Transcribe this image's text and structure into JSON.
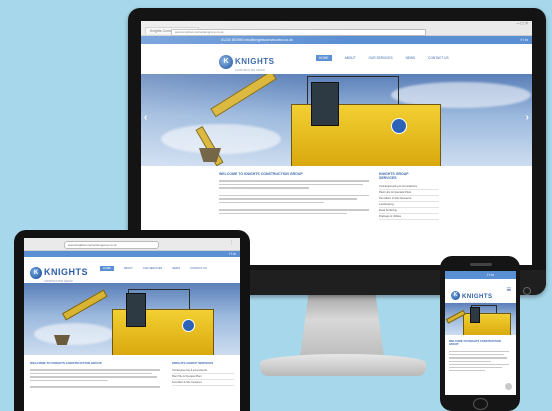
{
  "site": {
    "brand": "KNIGHTS",
    "brand_sub": "CONSTRUCTION GROUP",
    "logo_letter": "K",
    "browser_tab": "Knights Construction Group",
    "url": "www.knightsconstructiongroup.co.uk",
    "topbar_text": "01234 567890   info@knightsconstruction.co.uk",
    "social_icons": [
      "facebook-icon",
      "twitter-icon",
      "linkedin-icon"
    ],
    "social_glyphs": "f t in",
    "nav": [
      "HOME",
      "ABOUT",
      "OUR SERVICES",
      "NEWS",
      "CONTACT US"
    ],
    "welcome_heading": "WELCOME TO KNIGHTS CONSTRUCTION GROUP",
    "sidebar_title": "KNIGHTS GROUP SERVICES",
    "sidebar_items": [
      "Civil Engineering & Groundworks",
      "Plant Hire & Operated Plant",
      "Demolition & Site Clearance",
      "Landscaping",
      "Road Surfacing",
      "Drainage & Utilities"
    ],
    "slider_prev": "‹",
    "slider_next": "›"
  },
  "colors": {
    "accent": "#5b8fd4",
    "brand_blue": "#2c5fa8",
    "excavator_yellow": "#f2cf32",
    "background": "#a6d7ea"
  }
}
